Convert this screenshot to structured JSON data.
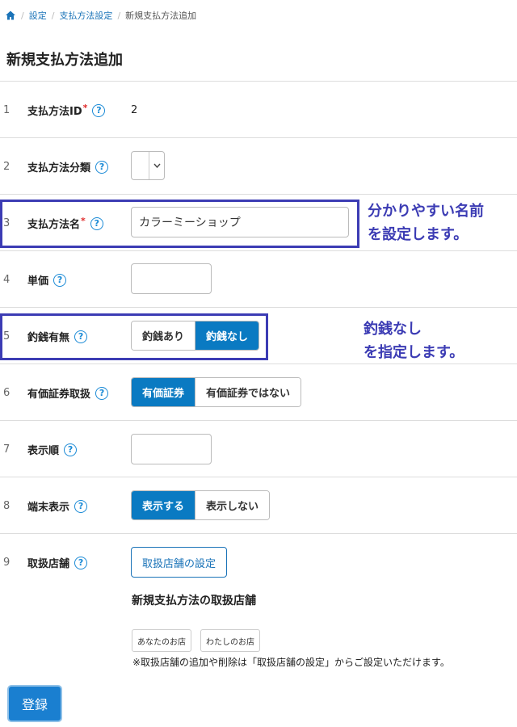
{
  "breadcrumb": {
    "items": [
      "設定",
      "支払方法設定"
    ],
    "current": "新規支払方法追加",
    "separator": "/"
  },
  "page": {
    "title": "新規支払方法追加"
  },
  "rows": [
    {
      "num": "1",
      "label": "支払方法ID",
      "required": "*",
      "value": "2"
    },
    {
      "num": "2",
      "label": "支払方法分類",
      "value": ""
    },
    {
      "num": "3",
      "label": "支払方法名",
      "required": "*",
      "value": "カラーミーショップ"
    },
    {
      "num": "4",
      "label": "単価",
      "value": ""
    },
    {
      "num": "5",
      "label": "釣銭有無",
      "options": [
        "釣銭あり",
        "釣銭なし"
      ],
      "selected": "釣銭なし"
    },
    {
      "num": "6",
      "label": "有価証券取扱",
      "options": [
        "有価証券",
        "有価証券ではない"
      ],
      "selected": "有価証券"
    },
    {
      "num": "7",
      "label": "表示順",
      "value": ""
    },
    {
      "num": "8",
      "label": "端末表示",
      "options": [
        "表示する",
        "表示しない"
      ],
      "selected": "表示する"
    },
    {
      "num": "9",
      "label": "取扱店舗",
      "button": "取扱店舗の設定",
      "subheading": "新規支払方法の取扱店舗",
      "stores": [
        "あなたのお店",
        "わたしのお店"
      ],
      "note": "※取扱店舗の追加や削除は「取扱店舗の設定」からご設定いただけます。"
    }
  ],
  "help_glyph": "?",
  "submit_label": "登録",
  "annotations": {
    "name_hint": [
      "分かりやすい名前",
      "を設定します。"
    ],
    "change_hint": [
      "釣銭なし",
      "を指定します。"
    ]
  },
  "colors": {
    "primary": "#0a7ac2",
    "link": "#1a73b8",
    "highlight": "#3c3cb4",
    "required": "#e02b2b"
  },
  "icons": [
    "home-icon",
    "help-icon",
    "chevron-down-icon"
  ]
}
